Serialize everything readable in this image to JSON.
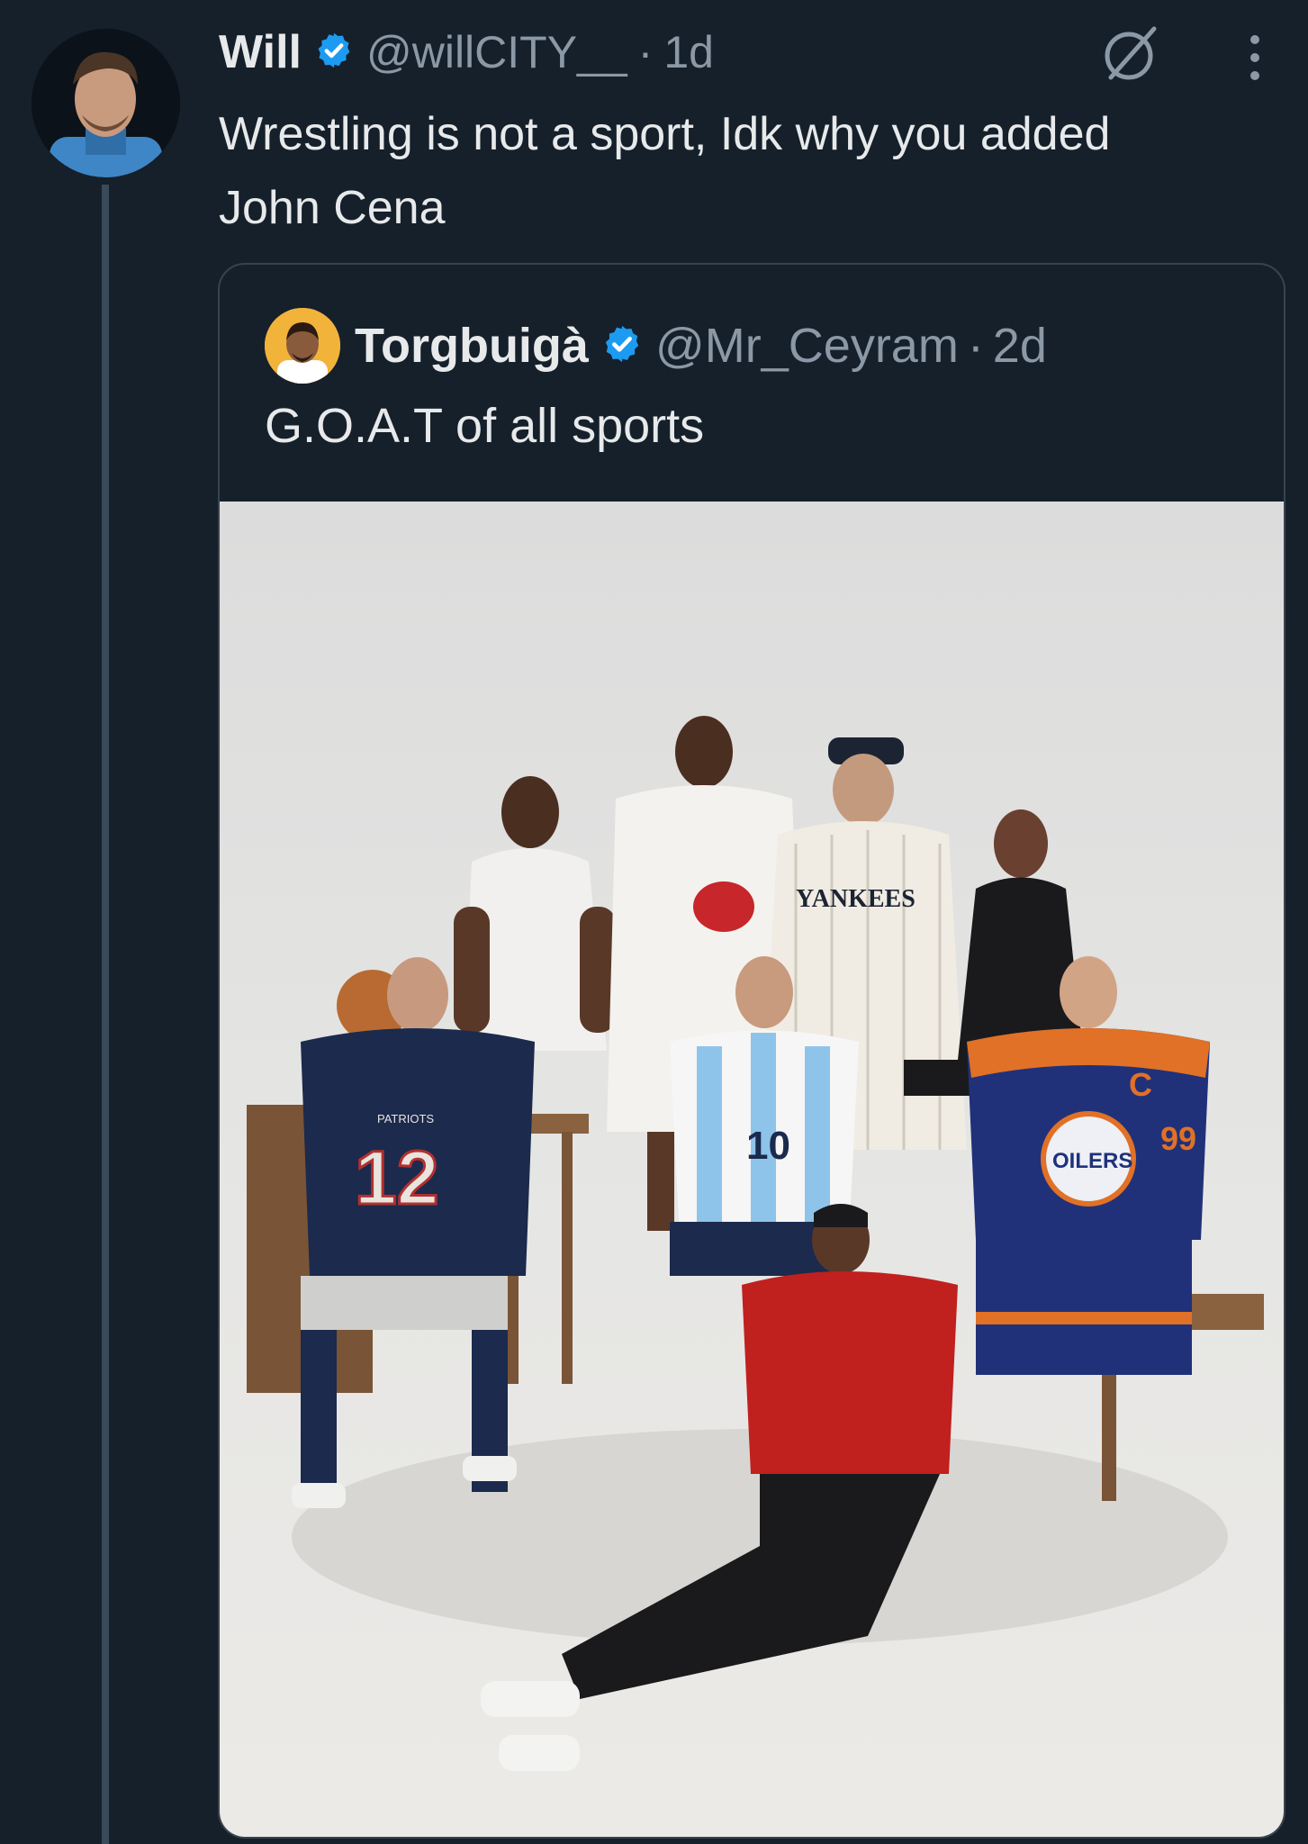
{
  "reply": {
    "name": "Will",
    "handle": "@willCITY__",
    "separator": "·",
    "time": "1d",
    "text": "Wrestling is not a sport, Idk why you added John Cena",
    "avatar_icon": "user-avatar",
    "verified_icon": "verified-badge-icon",
    "grok_icon": "grok-icon",
    "more_icon": "more-options-icon"
  },
  "quoted": {
    "name": "Torgbuigà",
    "handle": "@Mr_Ceyram",
    "separator": "·",
    "time": "2d",
    "text": "G.O.A.T of all sports",
    "avatar_icon": "user-avatar",
    "verified_icon": "verified-badge-icon"
  },
  "photo": {
    "jersey_patriots_number": "12",
    "jersey_patriots_wordmark": "PATRIOTS",
    "jersey_argentina_number": "10",
    "jersey_yankees_wordmark": "YANKEES",
    "jersey_oilers_wordmark": "OILERS",
    "jersey_oilers_number": "99",
    "jersey_oilers_captain": "C"
  },
  "colors": {
    "background": "#15202b",
    "text_primary": "#e7e9ea",
    "text_secondary": "#8b98a5",
    "verified_blue": "#1d9bf0",
    "border": "#38444d"
  }
}
